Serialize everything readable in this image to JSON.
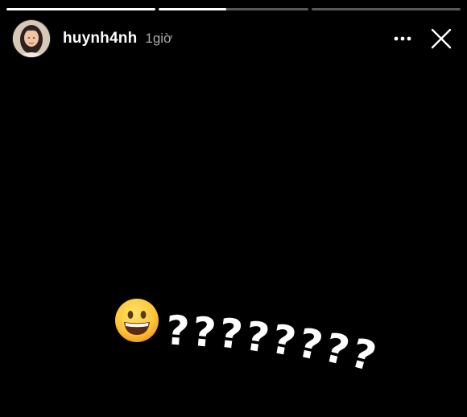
{
  "story": {
    "progress": [
      1.0,
      0.45,
      0.0
    ],
    "username": "huynh4nh",
    "time": "1giờ",
    "more_icon": "more-horizontal-icon",
    "close_icon": "close-icon",
    "sticker_emoji": "grinning-face-emoji",
    "sticker_text": "????????"
  }
}
